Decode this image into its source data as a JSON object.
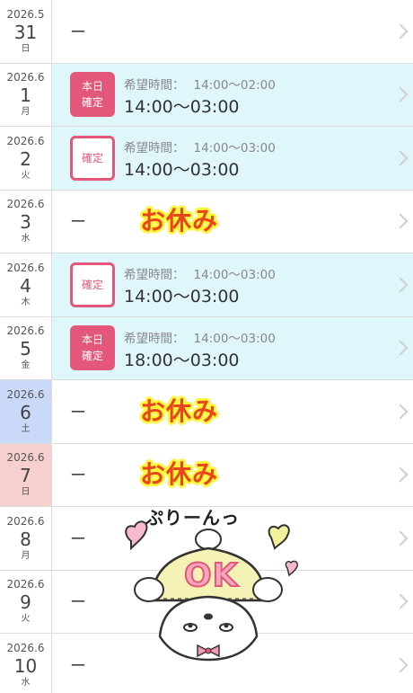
{
  "rows": [
    {
      "ym": "2026.5",
      "day": "31",
      "wd": "日",
      "dash": "ー"
    },
    {
      "ym": "2026.6",
      "day": "1",
      "wd": "月",
      "badge": [
        "本日",
        "確定"
      ],
      "req_label": "希望時間：",
      "req_value": "14:00〜02:00",
      "shift": "14:00〜03:00"
    },
    {
      "ym": "2026.6",
      "day": "2",
      "wd": "火",
      "badge": [
        "確定"
      ],
      "req_label": "希望時間：",
      "req_value": "14:00〜03:00",
      "shift": "14:00〜03:00"
    },
    {
      "ym": "2026.6",
      "day": "3",
      "wd": "水",
      "dash": "ー",
      "dayoff": "お休み"
    },
    {
      "ym": "2026.6",
      "day": "4",
      "wd": "木",
      "badge": [
        "確定"
      ],
      "req_label": "希望時間：",
      "req_value": "14:00〜03:00",
      "shift": "14:00〜03:00"
    },
    {
      "ym": "2026.6",
      "day": "5",
      "wd": "金",
      "badge": [
        "本日",
        "確定"
      ],
      "req_label": "希望時間：",
      "req_value": "14:00〜03:00",
      "shift": "18:00〜03:00"
    },
    {
      "ym": "2026.6",
      "day": "6",
      "wd": "土",
      "dash": "ー",
      "dayoff": "お休み"
    },
    {
      "ym": "2026.6",
      "day": "7",
      "wd": "日",
      "dash": "ー",
      "dayoff": "お休み"
    },
    {
      "ym": "2026.6",
      "day": "8",
      "wd": "月",
      "dash": "ー"
    },
    {
      "ym": "2026.6",
      "day": "9",
      "wd": "火",
      "dash": "ー"
    },
    {
      "ym": "2026.6",
      "day": "10",
      "wd": "水",
      "dash": "ー"
    }
  ],
  "sticker": {
    "caption": "ぷりーんっ",
    "ok": "OK"
  },
  "colors": {
    "accent": "#e2577a",
    "confirmed_bg": "#dff6fb",
    "saturday": "#c9d9f7",
    "sunday": "#f6cfcf",
    "dayoff_text": "#e8451f",
    "dayoff_glow": "#fff63a"
  }
}
